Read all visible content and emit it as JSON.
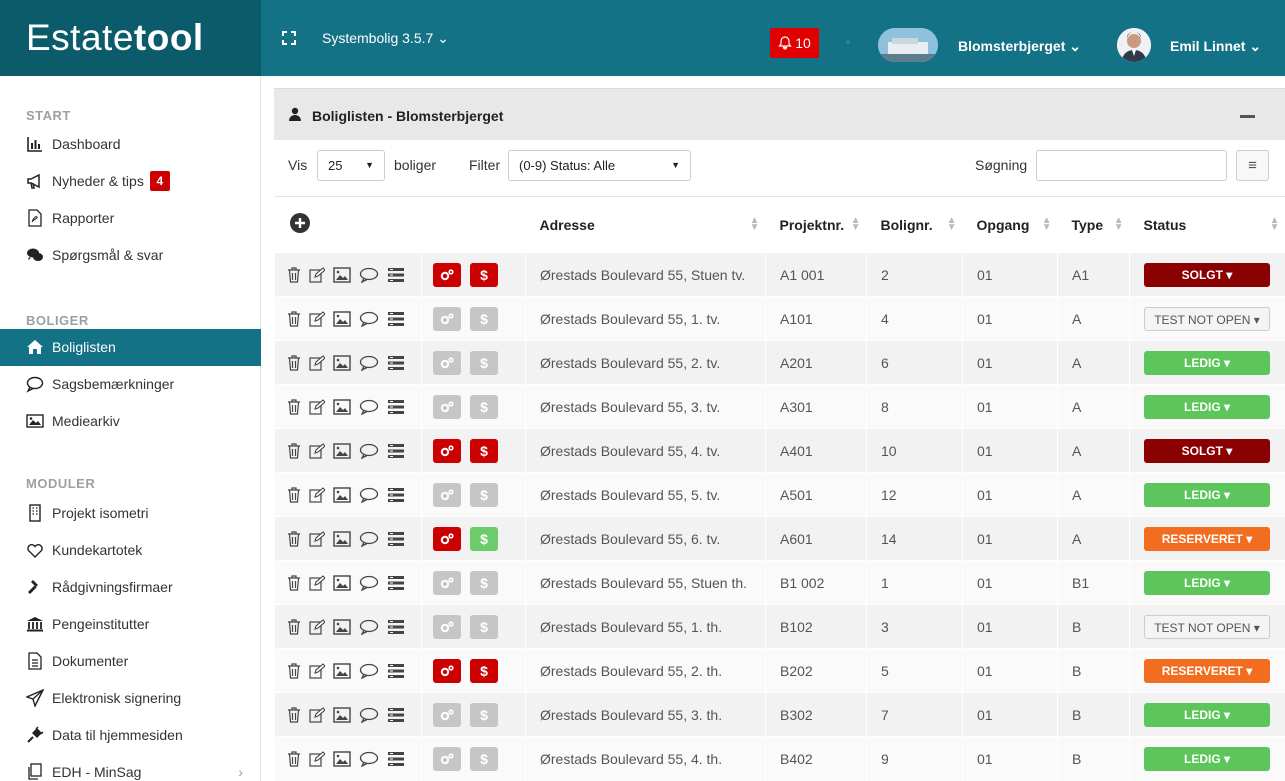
{
  "brand": {
    "light": "Estate",
    "bold": "tool"
  },
  "topbar": {
    "system": "Systembolig 3.5.7 ⌄",
    "notifications": "10",
    "project": "Blomsterbjerget ⌄",
    "user": "Emil Linnet ⌄"
  },
  "colors": {
    "teal": "#137285",
    "teal_dark": "#0b5b6b",
    "solgt": "#8b0000",
    "ledig": "#5cc55c",
    "reserveret": "#f26d1f",
    "alert_red": "#cc0000"
  },
  "sidebar": {
    "start_label": "START",
    "boliger_label": "BOLIGER",
    "moduler_label": "MODULER",
    "start": [
      {
        "label": "Dashboard",
        "icon": "bar-chart-icon"
      },
      {
        "label": "Nyheder & tips",
        "icon": "megaphone-icon",
        "badge": "4"
      },
      {
        "label": "Rapporter",
        "icon": "pdf-icon"
      },
      {
        "label": "Spørgsmål & svar",
        "icon": "chat-bubbles-icon"
      }
    ],
    "boliger": [
      {
        "label": "Boliglisten",
        "icon": "home-icon",
        "active": true
      },
      {
        "label": "Sagsbemærkninger",
        "icon": "comment-icon"
      },
      {
        "label": "Mediearkiv",
        "icon": "image-icon"
      }
    ],
    "moduler": [
      {
        "label": "Projekt isometri",
        "icon": "building-icon"
      },
      {
        "label": "Kundekartotek",
        "icon": "heart-icon"
      },
      {
        "label": "Rådgivningsfirmaer",
        "icon": "gavel-icon"
      },
      {
        "label": "Pengeinstitutter",
        "icon": "bank-icon"
      },
      {
        "label": "Dokumenter",
        "icon": "document-icon"
      },
      {
        "label": "Elektronisk signering",
        "icon": "send-icon"
      },
      {
        "label": "Data til hjemmesiden",
        "icon": "plug-icon"
      },
      {
        "label": "EDH - MinSag",
        "icon": "copy-icon",
        "chevron": "›"
      }
    ]
  },
  "panel": {
    "title": "Boliglisten - Blomsterbjerget",
    "vis_label": "Vis",
    "page_size": "25",
    "boliger_label": "boliger",
    "filter_label": "Filter",
    "filter_value": "(0-9) Status: Alle",
    "search_label": "Søgning",
    "search_value": ""
  },
  "table": {
    "columns": [
      "Adresse",
      "Projektnr.",
      "Bolignr.",
      "Opgang",
      "Type",
      "Status"
    ],
    "rows": [
      {
        "address": "Ørestads Boulevard 55, Stuen tv.",
        "projekt": "A1 001",
        "bolig": "2",
        "opgang": "01",
        "type": "A1",
        "status": "SOLGT ▾",
        "status_kind": "solgt",
        "btn1": "red",
        "btn2": "red"
      },
      {
        "address": "Ørestads Boulevard 55, 1. tv.",
        "projekt": "A101",
        "bolig": "4",
        "opgang": "01",
        "type": "A",
        "status": "TEST NOT OPEN ▾",
        "status_kind": "test",
        "btn1": "grey",
        "btn2": "grey"
      },
      {
        "address": "Ørestads Boulevard 55, 2. tv.",
        "projekt": "A201",
        "bolig": "6",
        "opgang": "01",
        "type": "A",
        "status": "LEDIG ▾",
        "status_kind": "ledig",
        "btn1": "grey",
        "btn2": "grey"
      },
      {
        "address": "Ørestads Boulevard 55, 3. tv.",
        "projekt": "A301",
        "bolig": "8",
        "opgang": "01",
        "type": "A",
        "status": "LEDIG ▾",
        "status_kind": "ledig",
        "btn1": "grey",
        "btn2": "grey"
      },
      {
        "address": "Ørestads Boulevard 55, 4. tv.",
        "projekt": "A401",
        "bolig": "10",
        "opgang": "01",
        "type": "A",
        "status": "SOLGT ▾",
        "status_kind": "solgt",
        "btn1": "red",
        "btn2": "red"
      },
      {
        "address": "Ørestads Boulevard 55, 5. tv.",
        "projekt": "A501",
        "bolig": "12",
        "opgang": "01",
        "type": "A",
        "status": "LEDIG ▾",
        "status_kind": "ledig",
        "btn1": "grey",
        "btn2": "grey"
      },
      {
        "address": "Ørestads Boulevard 55, 6. tv.",
        "projekt": "A601",
        "bolig": "14",
        "opgang": "01",
        "type": "A",
        "status": "RESERVERET ▾",
        "status_kind": "reserveret",
        "btn1": "red",
        "btn2": "green"
      },
      {
        "address": "Ørestads Boulevard 55, Stuen th.",
        "projekt": "B1 002",
        "bolig": "1",
        "opgang": "01",
        "type": "B1",
        "status": "LEDIG ▾",
        "status_kind": "ledig",
        "btn1": "grey",
        "btn2": "grey"
      },
      {
        "address": "Ørestads Boulevard 55, 1. th.",
        "projekt": "B102",
        "bolig": "3",
        "opgang": "01",
        "type": "B",
        "status": "TEST NOT OPEN ▾",
        "status_kind": "test",
        "btn1": "grey",
        "btn2": "grey"
      },
      {
        "address": "Ørestads Boulevard 55, 2. th.",
        "projekt": "B202",
        "bolig": "5",
        "opgang": "01",
        "type": "B",
        "status": "RESERVERET ▾",
        "status_kind": "reserveret",
        "btn1": "red",
        "btn2": "red"
      },
      {
        "address": "Ørestads Boulevard 55, 3. th.",
        "projekt": "B302",
        "bolig": "7",
        "opgang": "01",
        "type": "B",
        "status": "LEDIG ▾",
        "status_kind": "ledig",
        "btn1": "grey",
        "btn2": "grey"
      },
      {
        "address": "Ørestads Boulevard 55, 4. th.",
        "projekt": "B402",
        "bolig": "9",
        "opgang": "01",
        "type": "B",
        "status": "LEDIG ▾",
        "status_kind": "ledig",
        "btn1": "grey",
        "btn2": "grey"
      }
    ]
  }
}
